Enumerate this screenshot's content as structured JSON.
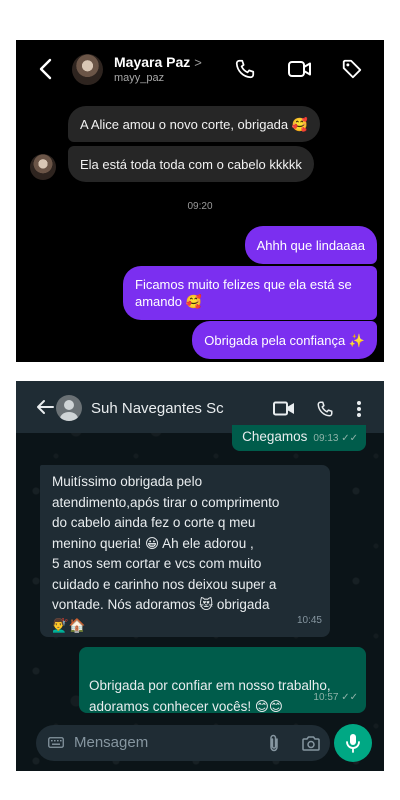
{
  "instagram": {
    "contact_name": "Mayara Paz",
    "name_chevron": ">",
    "username": "mayy_paz",
    "messages": [
      {
        "from": "them",
        "text": "A Alice amou o novo corte, obrigada 🥰"
      },
      {
        "from": "them",
        "text": "Ela está toda toda com o cabelo kkkkk"
      },
      {
        "from": "me",
        "text": "Ahhh que lindaaaa"
      },
      {
        "from": "me",
        "text": "Ficamos muito felizes que ela está se amando 🥰"
      },
      {
        "from": "me",
        "text": "Obrigada pela confiança ✨"
      }
    ],
    "time_separator": "09:20",
    "colors": {
      "background": "#000000",
      "incoming": "#262626",
      "outgoing": "#7b2ff0"
    }
  },
  "whatsapp": {
    "contact_name": "Suh Navegantes Sc",
    "messages": [
      {
        "from": "me",
        "text": "Chegamos",
        "time": "09:13",
        "read_ticks": "✓✓"
      },
      {
        "from": "them",
        "text": "Muitíssimo obrigada pelo\natendimento,após tirar o comprimento\ndo cabelo ainda fez o corte q meu\nmenino queria! 😀  Ah ele adorou ,\n5 anos sem cortar e vcs com muito\ncuidado e carinho nos deixou super a\nvontade. Nós adoramos 😻 obrigada\n💇‍♂️🏠",
        "time": "10:45"
      },
      {
        "from": "me",
        "text": "Obrigada por confiar em nosso trabalho,\nadoramos conhecer vocês! 😊😊",
        "time": "10:57",
        "read_ticks": "✓✓"
      }
    ],
    "input_placeholder": "Mensagem",
    "colors": {
      "header": "#1f2c34",
      "outgoing": "#005c4b",
      "incoming": "#1f2c34",
      "accent": "#00a884"
    }
  }
}
